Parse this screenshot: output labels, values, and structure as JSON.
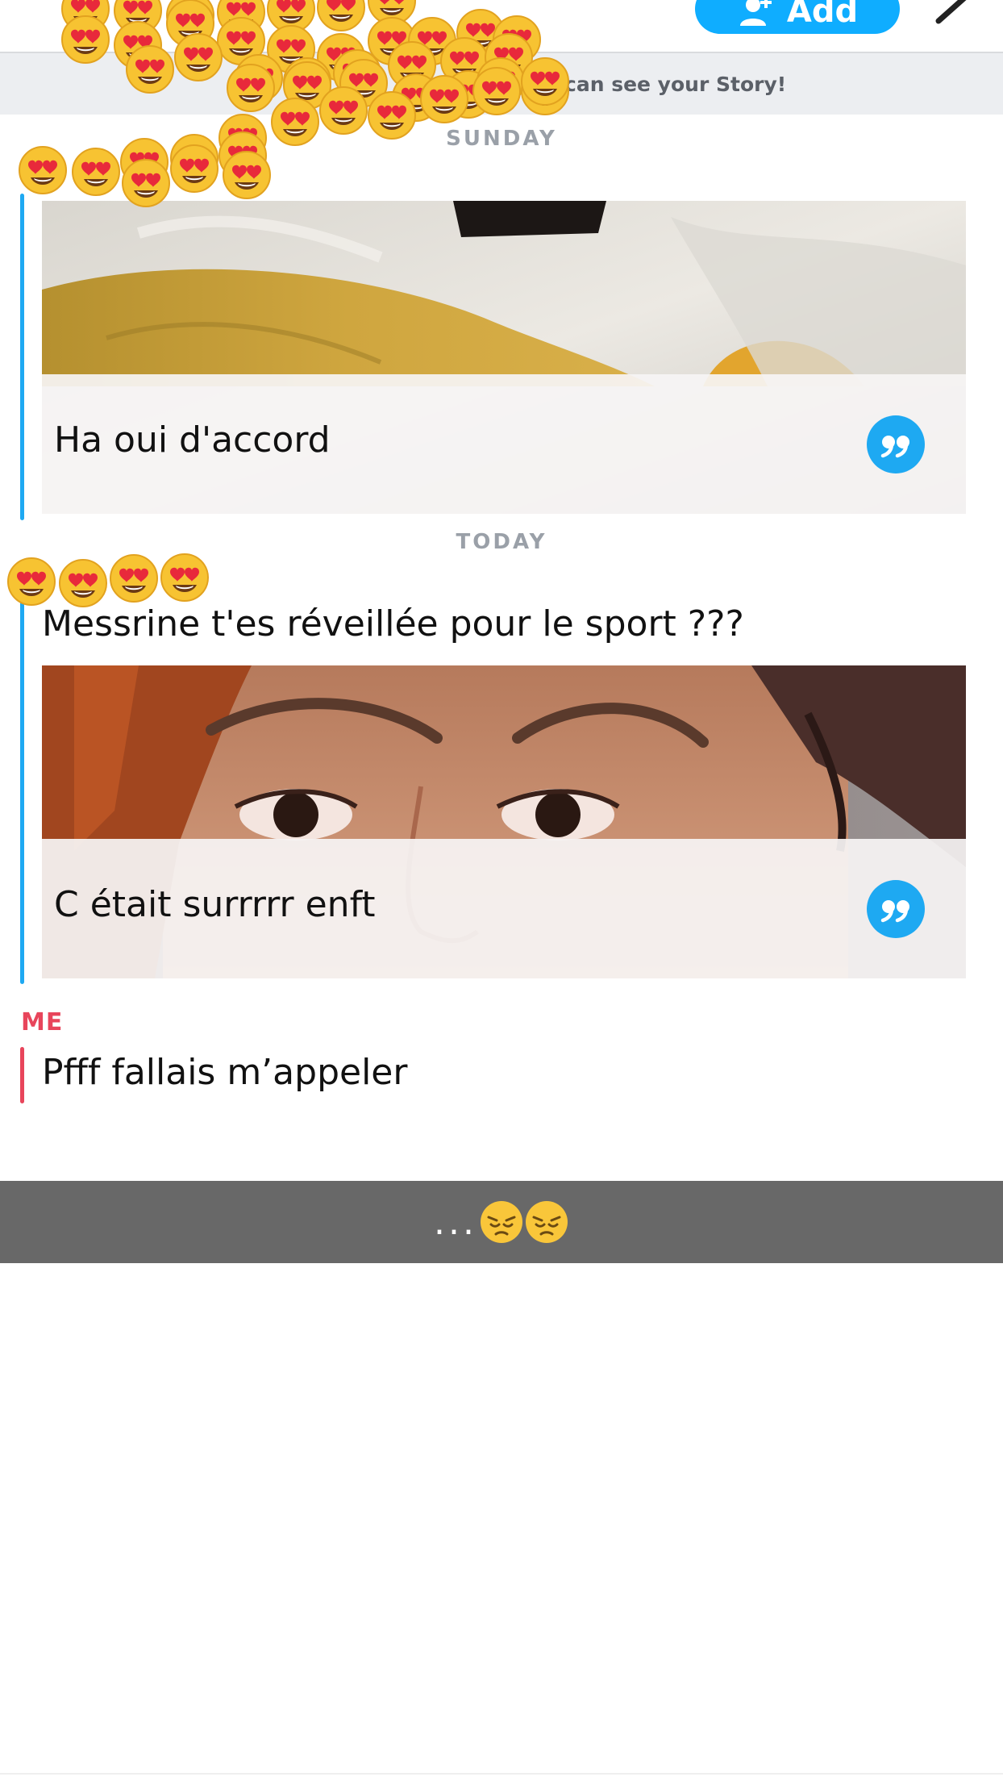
{
  "header": {
    "add_label": "Add",
    "add_icon": "add-friend-icon",
    "edit_icon": "edit-pencil-icon"
  },
  "story_banner": {
    "text": "can see your Story!"
  },
  "days": {
    "sunday": "SUNDAY",
    "today": "TODAY"
  },
  "messages": [
    {
      "sender_label": "",
      "text": "",
      "snap_caption": "Ha oui d'accord",
      "snap_icon": "quote-reply-icon"
    },
    {
      "sender_label": "",
      "text": "Messrine t'es réveillée pour le sport ???",
      "snap_caption": "C était surrrrr enft",
      "snap_icon": "quote-reply-icon"
    },
    {
      "sender_label": "ME",
      "text": "Pfff fallais m’appeler"
    }
  ],
  "typing_indicator": {
    "dots": "...",
    "emoji_icon": "pensive-face-emoji"
  },
  "overlay": {
    "emoji_icon": "heart-eyes-emoji"
  },
  "colors": {
    "accent_blue": "#0fadff",
    "friend_blue": "#1ea9f2",
    "me_red": "#e8455b",
    "banner_bg": "#eceef1",
    "typing_bg": "#686868"
  }
}
